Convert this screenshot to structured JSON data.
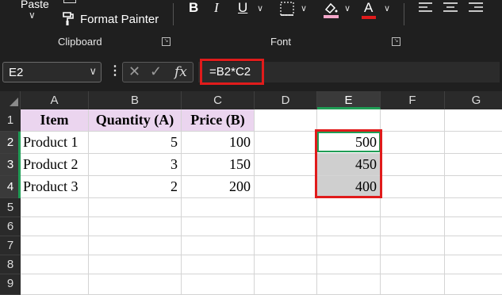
{
  "ribbon": {
    "paste_label": "Paste",
    "format_painter_label": "Format Painter",
    "clipboard_group_label": "Clipboard",
    "font_group_label": "Font",
    "bold_label": "B",
    "italic_label": "I",
    "underline_label": "U",
    "font_color_label": "A",
    "caret": "∨",
    "highlight_color": "#f3a7c9",
    "font_color": "#e01b1b"
  },
  "formula_bar": {
    "name_box_value": "E2",
    "fx_label": "fx",
    "formula": "=B2*C2"
  },
  "grid": {
    "columns": [
      "A",
      "B",
      "C",
      "D",
      "E",
      "F",
      "G"
    ],
    "selected_column": "E",
    "rows": [
      "1",
      "2",
      "3",
      "4",
      "5",
      "6",
      "7",
      "8",
      "9"
    ],
    "selected_rows": [
      "2",
      "3",
      "4"
    ],
    "header_row": {
      "a": "Item",
      "b": "Quantity (A)",
      "c": "Price (B)"
    },
    "data_rows": [
      {
        "a": "Product 1",
        "b": "5",
        "c": "100",
        "e": "500"
      },
      {
        "a": "Product 2",
        "b": "3",
        "c": "150",
        "e": "450"
      },
      {
        "a": "Product 3",
        "b": "2",
        "c": "200",
        "e": "400"
      }
    ],
    "header_fill": "#ebd5ef",
    "highlight_border_color": "#e01b1b",
    "selection_color": "#1f9d55"
  }
}
